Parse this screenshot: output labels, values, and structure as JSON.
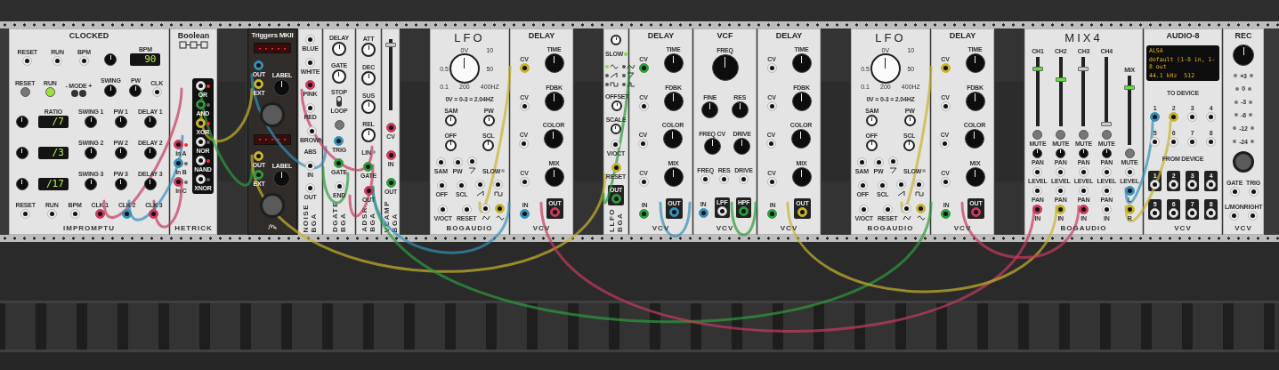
{
  "modules": [
    {
      "kind": "clocked",
      "title": "CLOCKED",
      "brand": "IMPROMPTU",
      "rows": [
        [
          {
            "kind": "jack",
            "label": "RESET"
          },
          {
            "kind": "jack",
            "label": "RUN"
          },
          {
            "kind": "jack",
            "label": "BPM"
          },
          {
            "kind": "knob"
          },
          {
            "kind": "display",
            "label": "BPM",
            "value": "90"
          }
        ],
        [
          {
            "kind": "button",
            "label": "RESET",
            "on": false
          },
          {
            "kind": "button",
            "label": "RUN",
            "on": true
          },
          {
            "kind": "button-pair",
            "label": "- MODE +"
          },
          {
            "kind": "knob",
            "label": "SWING"
          },
          {
            "kind": "knob",
            "label": "PW"
          },
          {
            "kind": "jack",
            "label": "CLK"
          }
        ],
        [
          {
            "kind": "knob"
          },
          {
            "kind": "display",
            "label": "RATIO",
            "value": "/7"
          },
          {
            "kind": "knob",
            "label": "SWING 1"
          },
          {
            "kind": "knob",
            "label": "PW 1"
          },
          {
            "kind": "knob",
            "label": "DELAY 1"
          }
        ],
        [
          {
            "kind": "knob"
          },
          {
            "kind": "display",
            "value": "/3"
          },
          {
            "kind": "knob",
            "label": "SWING 2"
          },
          {
            "kind": "knob",
            "label": "PW 2"
          },
          {
            "kind": "knob",
            "label": "DELAY 2"
          }
        ],
        [
          {
            "kind": "knob"
          },
          {
            "kind": "display",
            "value": "/17"
          },
          {
            "kind": "knob",
            "label": "SWING 3"
          },
          {
            "kind": "knob",
            "label": "PW 3"
          },
          {
            "kind": "knob",
            "label": "DELAY 3"
          }
        ],
        [
          {
            "kind": "jack",
            "label": "RESET"
          },
          {
            "kind": "jack",
            "label": "RUN"
          },
          {
            "kind": "jack",
            "label": "BPM"
          },
          {
            "kind": "jack",
            "label": "CLK 1",
            "color": "#c83a5e"
          },
          {
            "kind": "jack",
            "label": "CLK 2",
            "color": "#3590b8"
          },
          {
            "kind": "jack",
            "label": "CLK 3",
            "color": "#c83a5e"
          }
        ]
      ]
    },
    {
      "kind": "boolean",
      "title": "Boolean",
      "brand": "HETRICK",
      "rows": [
        [
          {
            "kind": "stack",
            "items": [
              {
                "kind": "jack",
                "label": "In A",
                "color": "#c83a5e",
                "led": true
              },
              {
                "kind": "jack",
                "label": "In B",
                "color": "#3590b8",
                "led": false
              },
              {
                "kind": "jack",
                "label": "In C",
                "color": "#c83a5e",
                "led": false
              }
            ]
          },
          {
            "kind": "dark-stack",
            "items": [
              {
                "kind": "jack",
                "label": "OR",
                "led": true
              },
              {
                "kind": "jack",
                "label": "AND",
                "color": "#2e9a3e",
                "led": false
              },
              {
                "kind": "jack",
                "label": "XOR",
                "color": "#c6b42c",
                "led": true
              },
              {
                "kind": "jack",
                "label": "NOR",
                "led": false
              },
              {
                "kind": "jack",
                "label": "NAND",
                "led": true
              },
              {
                "kind": "jack",
                "label": "XNOR",
                "led": false
              }
            ]
          }
        ]
      ]
    },
    {
      "kind": "empty-slot"
    },
    {
      "kind": "triggers",
      "title": "Triggers MKII",
      "rows": [
        [
          {
            "kind": "led-display"
          }
        ],
        [
          {
            "kind": "stack",
            "items": [
              {
                "kind": "jack",
                "label": "OUT",
                "color": "#3590b8"
              },
              {
                "kind": "jack",
                "label": "EXT",
                "color": "#c6b42c"
              }
            ]
          },
          {
            "kind": "knob",
            "label": "LABEL"
          }
        ],
        [
          {
            "kind": "big-button"
          }
        ],
        [
          {
            "kind": "led-display"
          }
        ],
        [
          {
            "kind": "stack",
            "items": [
              {
                "kind": "jack",
                "label": "OUT",
                "color": "#c6b42c"
              },
              {
                "kind": "jack",
                "label": "EXT",
                "color": "#2e9a3e"
              }
            ]
          },
          {
            "kind": "knob",
            "label": "LABEL"
          }
        ],
        [
          {
            "kind": "big-button"
          }
        ]
      ]
    },
    {
      "kind": "noise",
      "title": "NOISE",
      "brand": "BGA",
      "rows": [
        [
          {
            "kind": "jack",
            "label": "BLUE"
          }
        ],
        [
          {
            "kind": "jack",
            "label": "WHITE"
          }
        ],
        [
          {
            "kind": "jack",
            "label": "PINK",
            "color": "#c83a5e"
          }
        ],
        [
          {
            "kind": "jack",
            "label": "RED"
          }
        ],
        [
          {
            "kind": "jack",
            "label": "BROWN"
          }
        ],
        [
          {
            "kind": "text",
            "text": "ABS"
          }
        ],
        [
          {
            "kind": "jack",
            "label": "IN"
          }
        ],
        [
          {
            "kind": "jack",
            "label": "OUT"
          }
        ]
      ]
    },
    {
      "kind": "dgate",
      "title": "DGATE",
      "brand": "BGA",
      "rows": [
        [
          {
            "kind": "knob",
            "label": "DELAY"
          }
        ],
        [
          {
            "kind": "knob",
            "label": "GATE"
          }
        ],
        [
          {
            "kind": "switch",
            "top": "STOP",
            "bottom": "LOOP",
            "on": true
          }
        ],
        [
          {
            "kind": "button",
            "on": false
          }
        ],
        [
          {
            "kind": "jack",
            "label": "TRIG",
            "color": "#3590b8"
          }
        ],
        [
          {
            "kind": "jack",
            "label": "GATE",
            "color": "#2e9a3e"
          }
        ],
        [
          {
            "kind": "jack",
            "label": "END"
          }
        ]
      ]
    },
    {
      "kind": "adsr",
      "title": "ADSR",
      "brand": "BGA",
      "rows": [
        [
          {
            "kind": "knob",
            "label": "ATT"
          }
        ],
        [
          {
            "kind": "knob",
            "label": "DEC"
          }
        ],
        [
          {
            "kind": "knob",
            "label": "SUS"
          }
        ],
        [
          {
            "kind": "knob",
            "label": "REL"
          }
        ],
        [
          {
            "kind": "led",
            "label": "LIN",
            "on": false
          }
        ],
        [
          {
            "kind": "jack",
            "label": "GATE",
            "color": "#2e9a3e"
          }
        ],
        [
          {
            "kind": "jack",
            "label": "OUT",
            "color": "#c83a5e"
          }
        ]
      ]
    },
    {
      "kind": "vcamp",
      "title": "VCAMP",
      "brand": "BGA",
      "rows": [
        [
          {
            "kind": "fader",
            "level": 0.95,
            "lit": false
          }
        ],
        [
          {
            "kind": "jack",
            "label": "CV",
            "color": "#c83a5e"
          }
        ],
        [
          {
            "kind": "jack",
            "label": "IN",
            "color": "#c83a5e"
          }
        ],
        [
          {
            "kind": "jack",
            "label": "OUT",
            "color": "#2e9a3e"
          }
        ]
      ]
    },
    {
      "kind": "empty-slot"
    },
    {
      "kind": "lfo",
      "title": "LFO",
      "brand": "BOGAUDIO",
      "rows": [
        [
          {
            "kind": "big-knob",
            "scale": [
              "0V",
              "10",
              "0.5",
              "50",
              "0.1",
              "200",
              "400HZ"
            ]
          }
        ],
        [
          {
            "kind": "text",
            "text": "0V = 0-3 = 2.04HZ"
          }
        ],
        [
          {
            "kind": "knob",
            "label": "SAM"
          },
          {
            "kind": "knob",
            "label": "PW"
          }
        ],
        [
          {
            "kind": "knob",
            "label": "OFF"
          },
          {
            "kind": "knob",
            "label": "SCL"
          }
        ],
        [
          {
            "kind": "jack",
            "label": "SAM"
          },
          {
            "kind": "jack",
            "label": "PW"
          },
          {
            "kind": "ramp-output"
          },
          {
            "kind": "led",
            "label": "SLOW",
            "on": false
          }
        ],
        [
          {
            "kind": "jack",
            "label": "OFF"
          },
          {
            "kind": "jack",
            "label": "SCL"
          },
          {
            "kind": "saw-output"
          },
          {
            "kind": "square-output"
          }
        ],
        [
          {
            "kind": "jack",
            "label": "V/OCT"
          },
          {
            "kind": "jack",
            "label": "RESET"
          },
          {
            "kind": "triangle-output"
          },
          {
            "kind": "sine-output",
            "color": "#c6b42c"
          }
        ]
      ]
    },
    {
      "kind": "delay",
      "title": "DELAY",
      "brand": "VCV",
      "rows": [
        [
          {
            "kind": "jack",
            "label": "CV",
            "color": "#c6b42c"
          },
          {
            "kind": "knob",
            "label": "TIME"
          }
        ],
        [
          {
            "kind": "jack",
            "label": "CV"
          },
          {
            "kind": "knob",
            "label": "FDBK"
          }
        ],
        [
          {
            "kind": "jack",
            "label": "CV"
          },
          {
            "kind": "knob",
            "label": "COLOR"
          }
        ],
        [
          {
            "kind": "jack",
            "label": "CV"
          },
          {
            "kind": "knob",
            "label": "MIX"
          }
        ],
        [
          {
            "kind": "jack",
            "label": "IN",
            "color": "#3590b8"
          },
          {
            "kind": "jack",
            "label": "OUT",
            "output": true,
            "color": "#c83a5e"
          }
        ]
      ]
    },
    {
      "kind": "empty-slot"
    },
    {
      "kind": "llfo",
      "title": "LLFO",
      "brand": "BGA",
      "rows": [
        [
          {
            "kind": "knob"
          }
        ],
        [
          {
            "kind": "led",
            "label": "SLOW",
            "on": true
          }
        ],
        [
          {
            "kind": "wave-select",
            "options": [
              {
                "kind": "sine",
                "selected": true
              },
              {
                "kind": "triangle",
                "selected": false
              },
              {
                "kind": "saw",
                "selected": false
              },
              {
                "kind": "ramp",
                "selected": false
              },
              {
                "kind": "square",
                "selected": false
              },
              {
                "kind": "pulse",
                "selected": false
              }
            ]
          }
        ],
        [
          {
            "kind": "knob",
            "label": "OFFSET"
          }
        ],
        [
          {
            "kind": "knob",
            "label": "SCALE"
          }
        ],
        [
          {
            "kind": "jack",
            "label": "V/OCT"
          }
        ],
        [
          {
            "kind": "jack",
            "label": "RESET",
            "color": "#c6b42c"
          }
        ],
        [
          {
            "kind": "jack",
            "label": "OUT",
            "output": true,
            "color": "#2e9a3e"
          }
        ]
      ]
    },
    {
      "kind": "delay",
      "title": "DELAY",
      "brand": "VCV",
      "rows": [
        [
          {
            "kind": "jack",
            "label": "CV",
            "color": "#2e9a3e"
          },
          {
            "kind": "knob",
            "label": "TIME"
          }
        ],
        [
          {
            "kind": "jack",
            "label": "CV"
          },
          {
            "kind": "knob",
            "label": "FDBK"
          }
        ],
        [
          {
            "kind": "jack",
            "label": "CV"
          },
          {
            "kind": "knob",
            "label": "COLOR"
          }
        ],
        [
          {
            "kind": "jack",
            "label": "CV"
          },
          {
            "kind": "knob",
            "label": "MIX"
          }
        ],
        [
          {
            "kind": "jack",
            "label": "IN",
            "color": "#2e9a3e"
          },
          {
            "kind": "jack",
            "label": "OUT",
            "output": true,
            "color": "#3590b8"
          }
        ]
      ]
    },
    {
      "kind": "vcf",
      "title": "VCF",
      "brand": "VCV",
      "rows": [
        [
          {
            "kind": "big-knob",
            "label": "FREQ"
          }
        ],
        [
          {
            "kind": "knob",
            "label": "FINE"
          },
          {
            "kind": "knob",
            "label": "RES"
          }
        ],
        [
          {
            "kind": "knob",
            "label": "FREQ CV"
          },
          {
            "kind": "knob",
            "label": "DRIVE"
          }
        ],
        [
          {
            "kind": "jack",
            "label": "FREQ"
          },
          {
            "kind": "jack",
            "label": "RES"
          },
          {
            "kind": "jack",
            "label": "DRIVE"
          }
        ],
        [
          {
            "kind": "jack",
            "label": "IN",
            "color": "#3590b8"
          },
          {
            "kind": "jack",
            "label": "LPF",
            "output": true
          },
          {
            "kind": "jack",
            "label": "HPF",
            "output": true,
            "color": "#2e9a3e"
          }
        ]
      ]
    },
    {
      "kind": "delay",
      "title": "DELAY",
      "brand": "VCV",
      "rows": [
        [
          {
            "kind": "jack",
            "label": "CV"
          },
          {
            "kind": "knob",
            "label": "TIME"
          }
        ],
        [
          {
            "kind": "jack",
            "label": "CV"
          },
          {
            "kind": "knob",
            "label": "FDBK"
          }
        ],
        [
          {
            "kind": "jack",
            "label": "CV"
          },
          {
            "kind": "knob",
            "label": "COLOR"
          }
        ],
        [
          {
            "kind": "jack",
            "label": "CV"
          },
          {
            "kind": "knob",
            "label": "MIX"
          }
        ],
        [
          {
            "kind": "jack",
            "label": "IN",
            "color": "#2e9a3e"
          },
          {
            "kind": "jack",
            "label": "OUT",
            "output": true,
            "color": "#c6b42c"
          }
        ]
      ]
    },
    {
      "kind": "empty-slot"
    },
    {
      "kind": "lfo",
      "title": "LFO",
      "brand": "BOGAUDIO",
      "rows": [
        [
          {
            "kind": "big-knob",
            "scale": [
              "0V",
              "10",
              "0.5",
              "50",
              "0.1",
              "200",
              "400HZ"
            ]
          }
        ],
        [
          {
            "kind": "text",
            "text": "0V = 0-3 = 2.04HZ"
          }
        ],
        [
          {
            "kind": "knob",
            "label": "SAM"
          },
          {
            "kind": "knob",
            "label": "PW"
          }
        ],
        [
          {
            "kind": "knob",
            "label": "OFF"
          },
          {
            "kind": "knob",
            "label": "SCL"
          }
        ],
        [
          {
            "kind": "jack",
            "label": "SAM"
          },
          {
            "kind": "jack",
            "label": "PW"
          },
          {
            "kind": "ramp-output"
          },
          {
            "kind": "led",
            "label": "SLOW",
            "on": false
          }
        ],
        [
          {
            "kind": "jack",
            "label": "OFF"
          },
          {
            "kind": "jack",
            "label": "SCL"
          },
          {
            "kind": "saw-output"
          },
          {
            "kind": "square-output"
          }
        ],
        [
          {
            "kind": "jack",
            "label": "V/OCT"
          },
          {
            "kind": "jack",
            "label": "RESET"
          },
          {
            "kind": "triangle-output"
          },
          {
            "kind": "sine-output",
            "color": "#c6b42c"
          }
        ]
      ]
    },
    {
      "kind": "delay",
      "title": "DELAY",
      "brand": "VCV",
      "rows": [
        [
          {
            "kind": "jack",
            "label": "CV",
            "color": "#c6b42c"
          },
          {
            "kind": "knob",
            "label": "TIME"
          }
        ],
        [
          {
            "kind": "jack",
            "label": "CV"
          },
          {
            "kind": "knob",
            "label": "FDBK"
          }
        ],
        [
          {
            "kind": "jack",
            "label": "CV"
          },
          {
            "kind": "knob",
            "label": "COLOR"
          }
        ],
        [
          {
            "kind": "jack",
            "label": "CV"
          },
          {
            "kind": "knob",
            "label": "MIX"
          }
        ],
        [
          {
            "kind": "jack",
            "label": "IN",
            "color": "#2e9a3e"
          },
          {
            "kind": "jack",
            "label": "OUT",
            "output": true,
            "color": "#c83a5e"
          }
        ]
      ]
    },
    {
      "kind": "empty-slot"
    },
    {
      "kind": "mix4",
      "title": "MIX4",
      "brand": "BOGAUDIO",
      "rows": [
        [
          {
            "kind": "stack",
            "items": [
              {
                "kind": "fader",
                "label": "CH1",
                "level": 0.85,
                "lit": true
              },
              {
                "kind": "button",
                "label": "MUTE",
                "on": false
              },
              {
                "kind": "knob",
                "label": "PAN"
              },
              {
                "kind": "jack",
                "label": "LEVEL"
              },
              {
                "kind": "jack",
                "label": "PAN"
              },
              {
                "kind": "jack",
                "label": "IN",
                "color": "#c83a5e"
              }
            ]
          },
          {
            "kind": "stack",
            "items": [
              {
                "kind": "fader",
                "label": "CH2",
                "level": 0.68,
                "lit": true
              },
              {
                "kind": "button",
                "label": "MUTE",
                "on": false
              },
              {
                "kind": "knob",
                "label": "PAN"
              },
              {
                "kind": "jack",
                "label": "LEVEL"
              },
              {
                "kind": "jack",
                "label": "PAN"
              },
              {
                "kind": "jack",
                "label": "IN",
                "color": "#c6b42c"
              }
            ]
          },
          {
            "kind": "stack",
            "items": [
              {
                "kind": "fader",
                "label": "CH3",
                "level": 0.85,
                "lit": false
              },
              {
                "kind": "button",
                "label": "MUTE",
                "on": false
              },
              {
                "kind": "knob",
                "label": "PAN"
              },
              {
                "kind": "jack",
                "label": "LEVEL"
              },
              {
                "kind": "jack",
                "label": "PAN"
              },
              {
                "kind": "jack",
                "label": "IN",
                "color": "#c83a5e"
              }
            ]
          },
          {
            "kind": "stack",
            "items": [
              {
                "kind": "fader",
                "label": "CH4",
                "level": 0.0,
                "lit": false
              },
              {
                "kind": "button",
                "label": "MUTE",
                "on": false
              },
              {
                "kind": "knob",
                "label": "PAN"
              },
              {
                "kind": "jack",
                "label": "LEVEL"
              },
              {
                "kind": "jack",
                "label": "PAN"
              },
              {
                "kind": "jack",
                "label": "IN"
              }
            ]
          },
          {
            "kind": "stack",
            "items": [
              {
                "kind": "fader",
                "label": "MIX",
                "level": 0.85,
                "lit": true
              },
              {
                "kind": "button",
                "label": "MUTE",
                "on": false
              },
              {
                "kind": "jack",
                "label": "LEVEL"
              },
              {
                "kind": "jack",
                "label": "L",
                "color": "#3590b8"
              },
              {
                "kind": "jack",
                "label": "R",
                "color": "#c6b42c"
              }
            ]
          }
        ]
      ]
    },
    {
      "kind": "audio8",
      "title": "AUDIO-8",
      "brand": "VCV",
      "rows": [
        [
          {
            "kind": "screen",
            "lines": [
              [
                "ALSA"
              ],
              [
                "default (1-8 in, 1-8 out"
              ],
              [
                "44.1 kHz",
                "512"
              ]
            ]
          }
        ],
        [
          {
            "kind": "text",
            "text": "TO DEVICE"
          }
        ],
        [
          {
            "kind": "jack",
            "label": "1",
            "color": "#3590b8"
          },
          {
            "kind": "jack",
            "label": "2",
            "color": "#c6b42c"
          },
          {
            "kind": "jack",
            "label": "3"
          },
          {
            "kind": "jack",
            "label": "4"
          }
        ],
        [
          {
            "kind": "jack",
            "label": "5"
          },
          {
            "kind": "jack",
            "label": "6"
          },
          {
            "kind": "jack",
            "label": "7"
          },
          {
            "kind": "jack",
            "label": "8"
          }
        ],
        [
          {
            "kind": "text",
            "text": "FROM DEVICE"
          }
        ],
        [
          {
            "kind": "jack",
            "label": "1",
            "output": true
          },
          {
            "kind": "jack",
            "label": "2",
            "output": true
          },
          {
            "kind": "jack",
            "label": "3",
            "output": true
          },
          {
            "kind": "jack",
            "label": "4",
            "output": true
          }
        ],
        [
          {
            "kind": "jack",
            "label": "5",
            "output": true
          },
          {
            "kind": "jack",
            "label": "6",
            "output": true
          },
          {
            "kind": "jack",
            "label": "7",
            "output": true
          },
          {
            "kind": "jack",
            "label": "8",
            "output": true
          }
        ]
      ]
    },
    {
      "kind": "rec",
      "title": "REC",
      "brand": "VCV",
      "rows": [
        [
          {
            "kind": "knob"
          }
        ],
        [
          {
            "kind": "meter",
            "label": "+3"
          }
        ],
        [
          {
            "kind": "meter",
            "label": "0"
          }
        ],
        [
          {
            "kind": "meter",
            "label": "-3"
          }
        ],
        [
          {
            "kind": "meter",
            "label": "-6"
          }
        ],
        [
          {
            "kind": "meter",
            "label": "-12"
          }
        ],
        [
          {
            "kind": "meter",
            "label": "-24"
          }
        ],
        [
          {
            "kind": "big-button"
          }
        ],
        [
          {
            "kind": "jack",
            "label": "GATE"
          },
          {
            "kind": "jack",
            "label": "TRIG"
          }
        ],
        [
          {
            "kind": "jack",
            "label": "L/MON"
          },
          {
            "kind": "jack",
            "label": "RIGHT"
          }
        ]
      ]
    }
  ]
}
